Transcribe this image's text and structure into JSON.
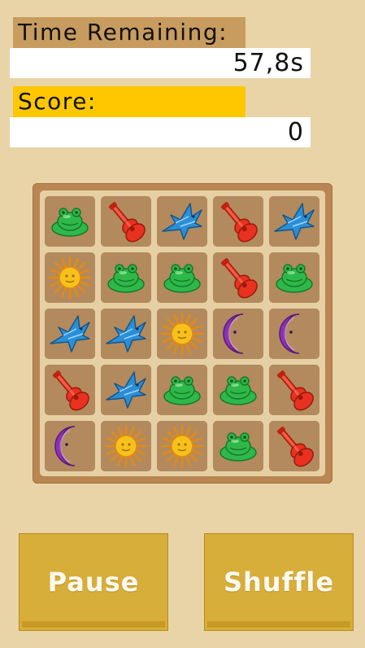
{
  "hud": {
    "time_label": "Time Remaining:",
    "time_value": "57,8s",
    "score_label": "Score:",
    "score_value": "0"
  },
  "board": {
    "rows": [
      [
        "frog",
        "guitar",
        "bird",
        "guitar",
        "bird"
      ],
      [
        "sun",
        "frog",
        "frog",
        "guitar",
        "frog"
      ],
      [
        "bird",
        "bird",
        "sun",
        "moon",
        "moon"
      ],
      [
        "guitar",
        "bird",
        "frog",
        "frog",
        "guitar"
      ],
      [
        "moon",
        "sun",
        "sun",
        "frog",
        "guitar"
      ]
    ]
  },
  "buttons": {
    "pause_label": "Pause",
    "shuffle_label": "Shuffle"
  },
  "colors": {
    "background": "#e9d4a7",
    "frog": "#2fb84a",
    "guitar": "#e8321f",
    "bird": "#2a8fd6",
    "sun": "#f5c21b",
    "moon": "#8e2fb8",
    "button": "#d7ae3a"
  }
}
